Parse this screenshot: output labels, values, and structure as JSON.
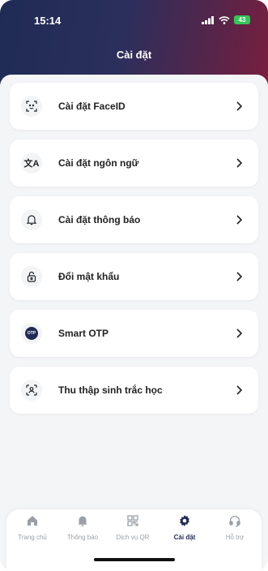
{
  "status": {
    "time": "15:14",
    "battery": "43"
  },
  "header": {
    "title": "Cài đặt"
  },
  "menu": [
    {
      "label": "Cài đặt FaceID",
      "icon": "faceid-icon"
    },
    {
      "label": "Cài đặt ngôn ngữ",
      "icon": "translate-icon"
    },
    {
      "label": "Cài đặt thông báo",
      "icon": "bell-icon"
    },
    {
      "label": "Đổi mật khẩu",
      "icon": "lock-icon"
    },
    {
      "label": "Smart OTP",
      "icon": "otp-icon",
      "badge": "OTP"
    },
    {
      "label": "Thu thập sinh trắc học",
      "icon": "biometric-scan-icon"
    }
  ],
  "tabs": [
    {
      "label": "Trang chủ",
      "icon": "home-icon",
      "active": false
    },
    {
      "label": "Thông báo",
      "icon": "bell-icon",
      "active": false
    },
    {
      "label": "Dịch vụ QR",
      "icon": "qr-icon",
      "active": false
    },
    {
      "label": "Cài đặt",
      "icon": "gear-icon",
      "active": true
    },
    {
      "label": "Hỗ trợ",
      "icon": "headset-icon",
      "active": false
    }
  ],
  "colors": {
    "header_start": "#1f2b55",
    "header_end": "#7a1f3d",
    "active_tab": "#1f2b55",
    "inactive_tab": "#9aa0a6"
  }
}
